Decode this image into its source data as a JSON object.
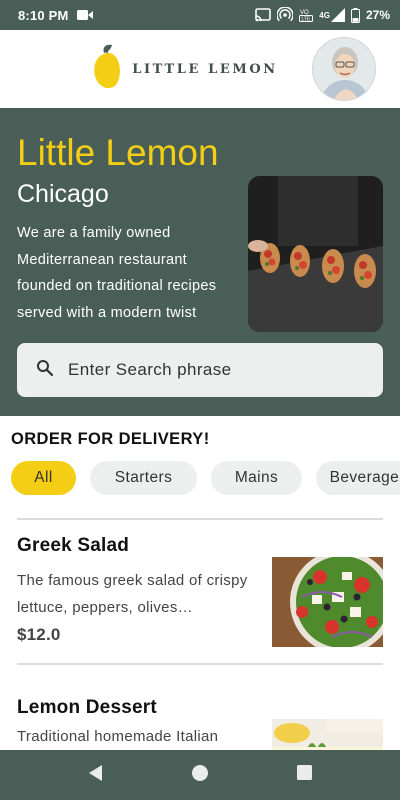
{
  "status_bar": {
    "time": "8:10 PM",
    "network": "4G",
    "lte": "LTE",
    "battery": "27%"
  },
  "header": {
    "brand_name": "LITTLE LEMON",
    "logo_icon": "lemon-logo-icon",
    "avatar_icon": "user-avatar"
  },
  "hero": {
    "title": "Little Lemon",
    "city": "Chicago",
    "description": "We are a family owned Mediterranean restaurant founded on traditional recipes served with a modern twist",
    "image_icon": "bruschetta-photo"
  },
  "search": {
    "placeholder": "Enter Search phrase",
    "icon": "search-icon"
  },
  "order": {
    "title": "ORDER FOR DELIVERY!",
    "categories": [
      {
        "label": "All",
        "active": true
      },
      {
        "label": "Starters",
        "active": false
      },
      {
        "label": "Mains",
        "active": false
      },
      {
        "label": "Beverages",
        "active": false
      }
    ]
  },
  "menu": [
    {
      "name": "Greek Salad",
      "description": "The famous greek salad of crispy lettuce, peppers, olives…",
      "price": "$12.0",
      "image_icon": "greek-salad-photo"
    },
    {
      "name": "Lemon Dessert",
      "description": "Traditional homemade Italian",
      "price": "",
      "image_icon": "lemon-dessert-photo"
    }
  ],
  "colors": {
    "primary_green": "#495e57",
    "primary_yellow": "#f4ce14",
    "chip_bg": "#edefee"
  }
}
